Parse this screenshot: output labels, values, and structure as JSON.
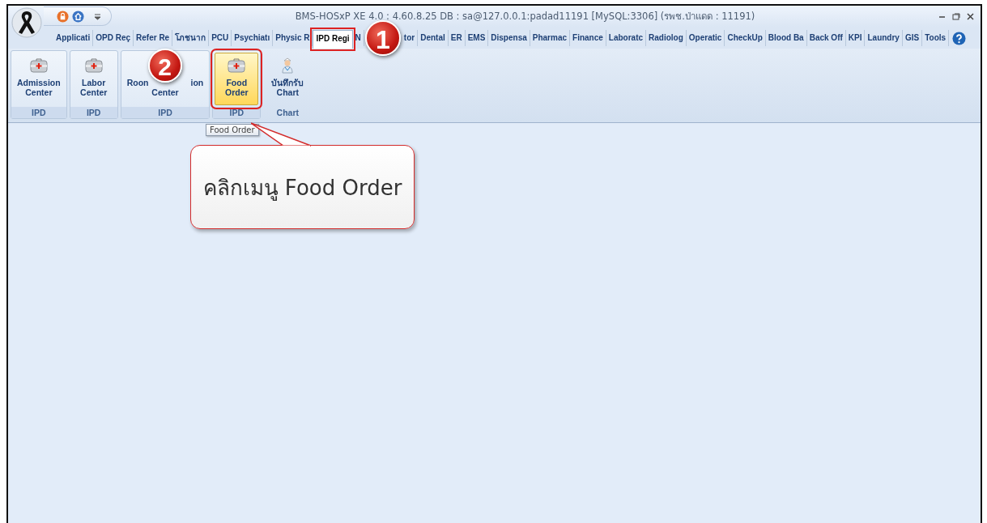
{
  "window": {
    "title": "BMS-HOSxP XE 4.0 : 4.60.8.25 DB : sa@127.0.0.1:padad11191 [MySQL:3306] (รพช.ป่าแดด : 11191)"
  },
  "tabs": [
    {
      "label": "Applicati",
      "selected": false
    },
    {
      "label": "OPD Reç",
      "selected": false
    },
    {
      "label": "Refer Re",
      "selected": false
    },
    {
      "label": "โภชนาก",
      "selected": false
    },
    {
      "label": "PCU",
      "selected": false
    },
    {
      "label": "Psychiatı",
      "selected": false
    },
    {
      "label": "Physic R",
      "selected": false
    },
    {
      "label": "IPD Regi",
      "selected": true
    },
    {
      "label": "N",
      "selected": false
    },
    {
      "label": "tor",
      "selected": false
    },
    {
      "label": "Dental",
      "selected": false
    },
    {
      "label": "ER",
      "selected": false
    },
    {
      "label": "EMS",
      "selected": false
    },
    {
      "label": "Dispensa",
      "selected": false
    },
    {
      "label": "Pharmac",
      "selected": false
    },
    {
      "label": "Finance",
      "selected": false
    },
    {
      "label": "Laboratc",
      "selected": false
    },
    {
      "label": "Radiolog",
      "selected": false
    },
    {
      "label": "Operatic",
      "selected": false
    },
    {
      "label": "CheckUp",
      "selected": false
    },
    {
      "label": "Blood Ba",
      "selected": false
    },
    {
      "label": "Back Off",
      "selected": false
    },
    {
      "label": "KPI",
      "selected": false
    },
    {
      "label": "Laundry",
      "selected": false
    },
    {
      "label": "GIS",
      "selected": false
    },
    {
      "label": "Tools",
      "selected": false
    }
  ],
  "ribbon": {
    "groups": [
      {
        "caption": "IPD",
        "buttons": [
          {
            "kind": "kit",
            "lines": [
              [
                "Admission"
              ],
              [
                "Center"
              ]
            ],
            "selected": false
          }
        ]
      },
      {
        "caption": "IPD",
        "buttons": [
          {
            "kind": "kit",
            "lines": [
              [
                "Labor"
              ],
              [
                "Center"
              ]
            ],
            "selected": false
          }
        ]
      },
      {
        "caption": "IPD",
        "buttons": [
          {
            "kind": "covered",
            "lines": [
              [
                "Roon",
                "ion"
              ],
              [
                "Center"
              ]
            ],
            "selected": false
          }
        ]
      },
      {
        "caption": "IPD",
        "buttons": [
          {
            "kind": "kit",
            "lines": [
              [
                "Food"
              ],
              [
                "Order"
              ]
            ],
            "selected": true
          }
        ]
      },
      {
        "caption": "Chart",
        "buttons": [
          {
            "kind": "nurse",
            "lines": [
              [
                "บันทึกรับ"
              ],
              [
                "Chart"
              ]
            ],
            "selected": false
          }
        ]
      }
    ]
  },
  "tooltip": {
    "text": "Food Order"
  },
  "callout": {
    "text": "คลิกเมนู Food Order"
  },
  "step_markers": [
    {
      "text": "1"
    },
    {
      "text": "2"
    }
  ]
}
